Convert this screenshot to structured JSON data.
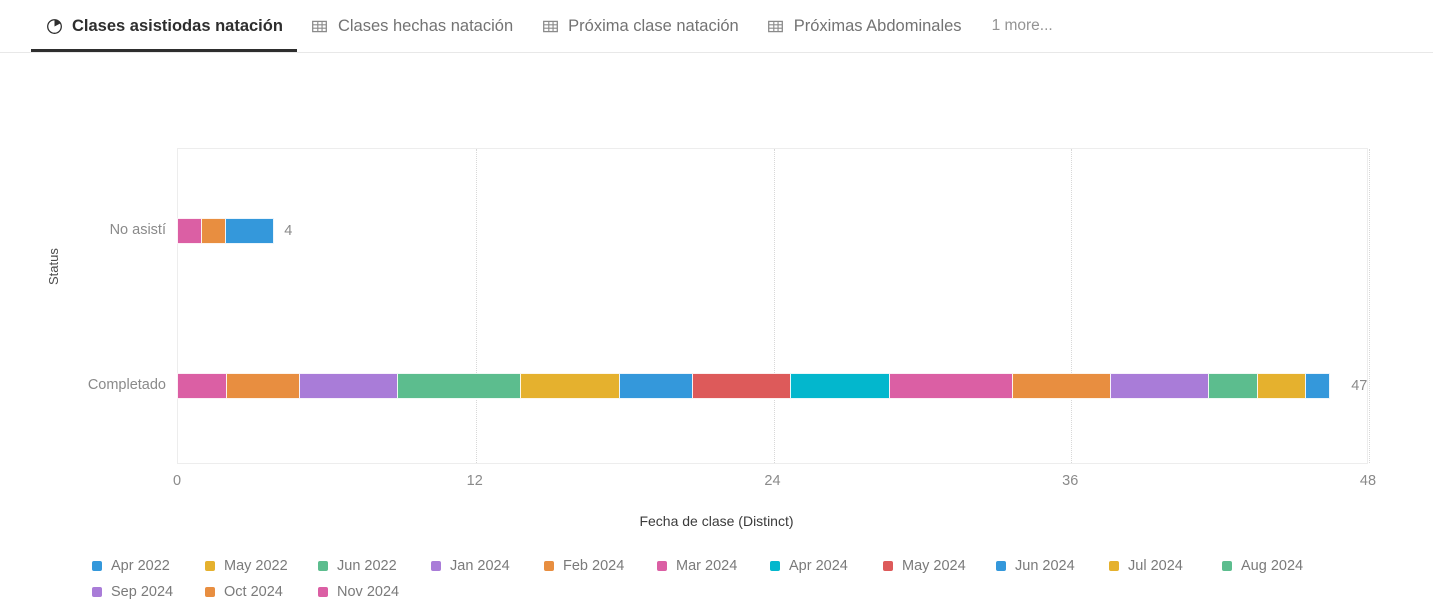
{
  "tabs": [
    {
      "label": "Clases asistiodas natación",
      "icon": "clock-pie-icon",
      "active": true
    },
    {
      "label": "Clases hechas natación",
      "icon": "table-icon",
      "active": false
    },
    {
      "label": "Próxima clase natación",
      "icon": "table-icon",
      "active": false
    },
    {
      "label": "Próximas Abdominales",
      "icon": "table-icon",
      "active": false
    }
  ],
  "more_link": "1 more...",
  "chart_data": {
    "type": "bar",
    "orientation": "horizontal",
    "stacked": true,
    "title": "",
    "xlabel": "Fecha de clase (Distinct)",
    "ylabel": "Status",
    "categories": [
      "No asistí",
      "Completado"
    ],
    "totals": [
      4,
      47
    ],
    "xlim": [
      0,
      48
    ],
    "xticks": [
      0,
      12,
      24,
      36,
      48
    ],
    "xtick_labels": [
      "0",
      "12",
      "24",
      "36",
      "48"
    ],
    "grid": true,
    "legend_position": "bottom",
    "legend": [
      {
        "name": "Apr 2022",
        "color": "#3498db"
      },
      {
        "name": "May 2022",
        "color": "#e5b12e"
      },
      {
        "name": "Jun 2022",
        "color": "#5cbd8e"
      },
      {
        "name": "Jan 2024",
        "color": "#a97cd8"
      },
      {
        "name": "Feb 2024",
        "color": "#e88e40"
      },
      {
        "name": "Mar 2024",
        "color": "#db5fa4"
      },
      {
        "name": "Apr 2024",
        "color": "#03b7cd"
      },
      {
        "name": "May 2024",
        "color": "#dd5a5a"
      },
      {
        "name": "Jun 2024",
        "color": "#3498db"
      },
      {
        "name": "Jul 2024",
        "color": "#e5b12e"
      },
      {
        "name": "Aug 2024",
        "color": "#5cbd8e"
      },
      {
        "name": "Sep 2024",
        "color": "#a97cd8"
      },
      {
        "name": "Oct 2024",
        "color": "#e88e40"
      },
      {
        "name": "Nov 2024",
        "color": "#db5fa4"
      }
    ],
    "bars": [
      {
        "category": "No asistí",
        "total": 4,
        "segments": [
          {
            "series": "Nov 2024",
            "value": 1,
            "color": "#db5fa4"
          },
          {
            "series": "Oct 2024",
            "value": 1,
            "color": "#e88e40"
          },
          {
            "series": "Apr 2022",
            "value": 2,
            "color": "#3498db"
          }
        ]
      },
      {
        "category": "Completado",
        "total": 47,
        "segments": [
          {
            "series": "Mar 2024",
            "value": 2,
            "color": "#db5fa4"
          },
          {
            "series": "Feb 2024",
            "value": 3,
            "color": "#e88e40"
          },
          {
            "series": "Jan 2024",
            "value": 4,
            "color": "#a97cd8"
          },
          {
            "series": "Jun 2022",
            "value": 5,
            "color": "#5cbd8e"
          },
          {
            "series": "May 2022",
            "value": 4,
            "color": "#e5b12e"
          },
          {
            "series": "Jun 2024",
            "value": 3,
            "color": "#3498db"
          },
          {
            "series": "May 2024",
            "value": 4,
            "color": "#dd5a5a"
          },
          {
            "series": "Apr 2024",
            "value": 4,
            "color": "#03b7cd"
          },
          {
            "series": "Mar 2024",
            "value": 5,
            "color": "#db5fa4"
          },
          {
            "series": "Feb 2024",
            "value": 4,
            "color": "#e88e40"
          },
          {
            "series": "Sep 2024",
            "value": 4,
            "color": "#a97cd8"
          },
          {
            "series": "Aug 2024",
            "value": 2,
            "color": "#5cbd8e"
          },
          {
            "series": "Jul 2024",
            "value": 2,
            "color": "#e5b12e"
          },
          {
            "series": "Jun 2024",
            "value": 1,
            "color": "#3498db"
          }
        ]
      }
    ]
  }
}
